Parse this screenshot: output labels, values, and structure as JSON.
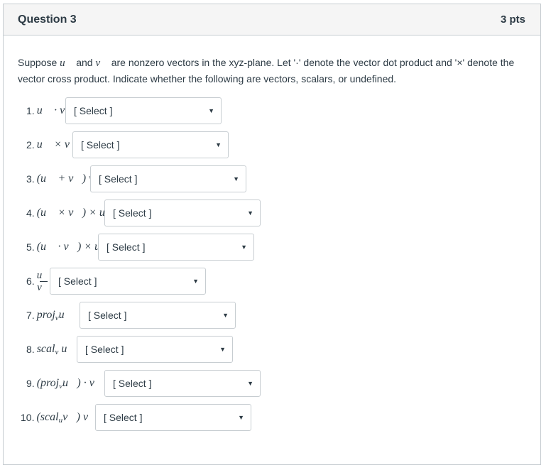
{
  "question": {
    "title": "Question 3",
    "points": "3 pts"
  },
  "intro": {
    "part1": "Suppose ",
    "u": "u⃗",
    "part2": " and ",
    "v": "v⃗",
    "part3": " are nonzero vectors in the xyz-plane.  Let '·' denote the vector dot product and '×' denote the vector cross product.  Indicate whether the following are vectors, scalars, or undefined."
  },
  "select_placeholder": "[ Select ]",
  "items": [
    {
      "num": "1.",
      "expr": "u⃗ · v⃗"
    },
    {
      "num": "2.",
      "expr": "u⃗ × v⃗"
    },
    {
      "num": "3.",
      "expr": "(u⃗ + v⃗) v⃗"
    },
    {
      "num": "4.",
      "expr": "(u⃗ × v⃗) × u⃗"
    },
    {
      "num": "5.",
      "expr": "(u⃗ · v⃗) × u⃗"
    },
    {
      "num": "6.",
      "frac_num": "u⃗",
      "frac_den": "v⃗"
    },
    {
      "num": "7.",
      "expr_main": "proj",
      "expr_sub": "v",
      "expr_tail": "u⃗"
    },
    {
      "num": "8.",
      "expr_main": "scal",
      "expr_sub": "v",
      "expr_tail": " u⃗"
    },
    {
      "num": "9.",
      "expr_pre": "(proj",
      "expr_sub": "v",
      "expr_tail": "u⃗) · v⃗"
    },
    {
      "num": "10.",
      "expr_pre": "(scal",
      "expr_sub": "u",
      "expr_tail": "v⃗) v⃗"
    }
  ]
}
